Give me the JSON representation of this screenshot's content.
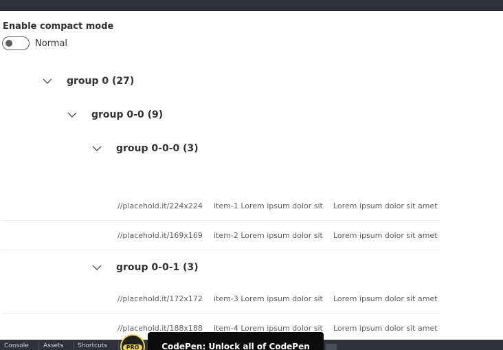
{
  "compact_toggle": {
    "label": "Enable compact mode",
    "state_text": "Normal",
    "checked": false
  },
  "groups": [
    {
      "title": "group 0 (27)",
      "expanded": true
    },
    {
      "title": "group 0-0 (9)",
      "expanded": true
    },
    {
      "title": "group 0-0-0 (3)",
      "expanded": true
    },
    {
      "title": "group 0-0-1 (3)",
      "expanded": true
    }
  ],
  "rows": [
    {
      "thumbnail": "//placehold.it/224x224",
      "key": "item-1 Lorem ipsum dolor sit",
      "description": "Lorem ipsum dolor sit amet,"
    },
    {
      "thumbnail": "//placehold.it/169x169",
      "key": "item-2 Lorem ipsum dolor sit",
      "description": "Lorem ipsum dolor sit amet,"
    },
    {
      "thumbnail": "//placehold.it/172x172",
      "key": "item-3 Lorem ipsum dolor sit",
      "description": "Lorem ipsum dolor sit amet,"
    },
    {
      "thumbnail": "//placehold.it/188x188",
      "key": "item-4 Lorem ipsum dolor sit",
      "description": "Lorem ipsum dolor sit amet,"
    }
  ],
  "footer": {
    "items": [
      "Console",
      "Assets",
      "Shortcuts"
    ],
    "promo_text": "CodePen: Unlock all of CodePen",
    "pro_badge": "PRO"
  },
  "colors": {
    "chrome": "#2f323a",
    "text": "#323130",
    "muted_text": "#605e5c",
    "divider": "#edebe9",
    "pro_yellow": "#f0d54a"
  },
  "icons": {
    "expand": "chevron-down-icon"
  }
}
